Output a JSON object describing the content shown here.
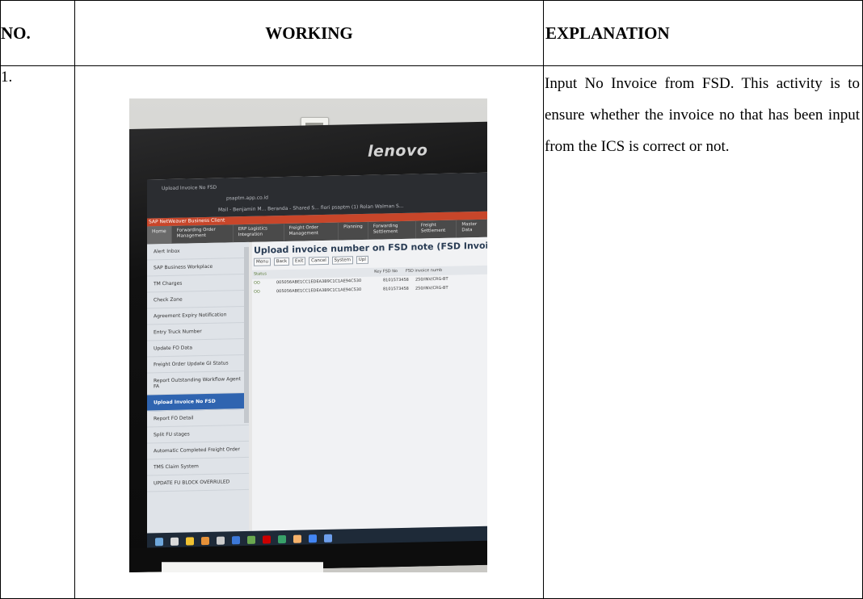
{
  "headers": {
    "no": "NO.",
    "working": "WORKING",
    "explanation": "EXPLANATION"
  },
  "row": {
    "number": "1.",
    "explanation": "Input No Invoice from FSD. This activity is to ensure whether the invoice no that has been input from the ICS is correct or not."
  },
  "photo": {
    "brand": "lenovo",
    "browser_tab": "Upload Invoice No FSD",
    "url": "psaptm.app.co.id",
    "bookmarks": "Mail - Benjamin M...   Beranda - Shared S...   fiori   psaptm   (1) Rolan Walman S...",
    "sap_header": "SAP NetWeaver Business Client",
    "nav": [
      "Home",
      "Forwarding Order Management",
      "ERP Logistics Integration",
      "Freight Order Management",
      "Planning",
      "Forwarding Settlement",
      "Freight Settlement",
      "Master Data"
    ],
    "sidebar": [
      "Alert Inbox",
      "SAP Business Workplace",
      "TM Charges",
      "Check Zone",
      "Agreement Expiry Notification",
      "Entry Truck Number",
      "Update FO Data",
      "Freight Order Update GI Status",
      "Report Outstanding Workflow Agent FA",
      "Upload Invoice No FSD",
      "Report FO Detail",
      "Split FU stages",
      "Automatic Completed Freight Order",
      "TMS Claim System",
      "UPDATE FU BLOCK OVERRULED"
    ],
    "content_title": "Upload invoice number on FSD note (FSD Invoice Num",
    "toolbar": [
      "Menu",
      "Back",
      "Exit",
      "Cancel",
      "System",
      "Upl"
    ],
    "grid_headers": [
      "Status",
      "Key FSD No",
      "FSD invoice numb"
    ],
    "grid_rows": [
      {
        "status": "OO",
        "key": "005056ABE1CC1EDEA3B9C1C1AE94C530",
        "fsd": "8101573458",
        "inv": "250/INV/CRG-BT"
      },
      {
        "status": "OO",
        "key": "005056ABE1CC1EDEA3B9C1C1AE94C530",
        "fsd": "8101573458",
        "inv": "250/INV/CRG-BT"
      }
    ]
  }
}
